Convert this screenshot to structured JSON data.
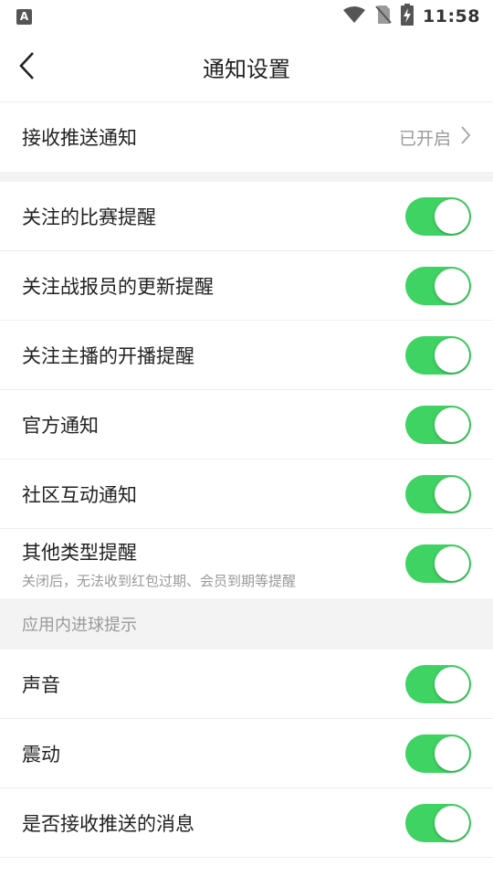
{
  "status_bar": {
    "time": "11:58",
    "app_icon_letter": "A",
    "icons": [
      "wifi-icon",
      "no-sim-icon",
      "battery-charging-icon"
    ]
  },
  "header": {
    "title": "通知设置",
    "back_icon": "chevron-left-icon"
  },
  "push_row": {
    "label": "接收推送通知",
    "value": "已开启",
    "arrow_icon": "chevron-right-icon"
  },
  "notifications": [
    {
      "label": "关注的比赛提醒",
      "enabled": true
    },
    {
      "label": "关注战报员的更新提醒",
      "enabled": true
    },
    {
      "label": "关注主播的开播提醒",
      "enabled": true
    },
    {
      "label": "官方通知",
      "enabled": true
    },
    {
      "label": "社区互动通知",
      "enabled": true
    },
    {
      "label": "其他类型提醒",
      "sub": "关闭后，无法收到红包过期、会员到期等提醒",
      "enabled": true
    }
  ],
  "in_app_section": {
    "title": "应用内进球提示",
    "items": [
      {
        "label": "声音",
        "enabled": true
      },
      {
        "label": "震动",
        "enabled": true
      },
      {
        "label": "是否接收推送的消息",
        "enabled": true
      }
    ]
  },
  "colors": {
    "toggle_on": "#3fd363",
    "separator": "#f3f3f3"
  }
}
